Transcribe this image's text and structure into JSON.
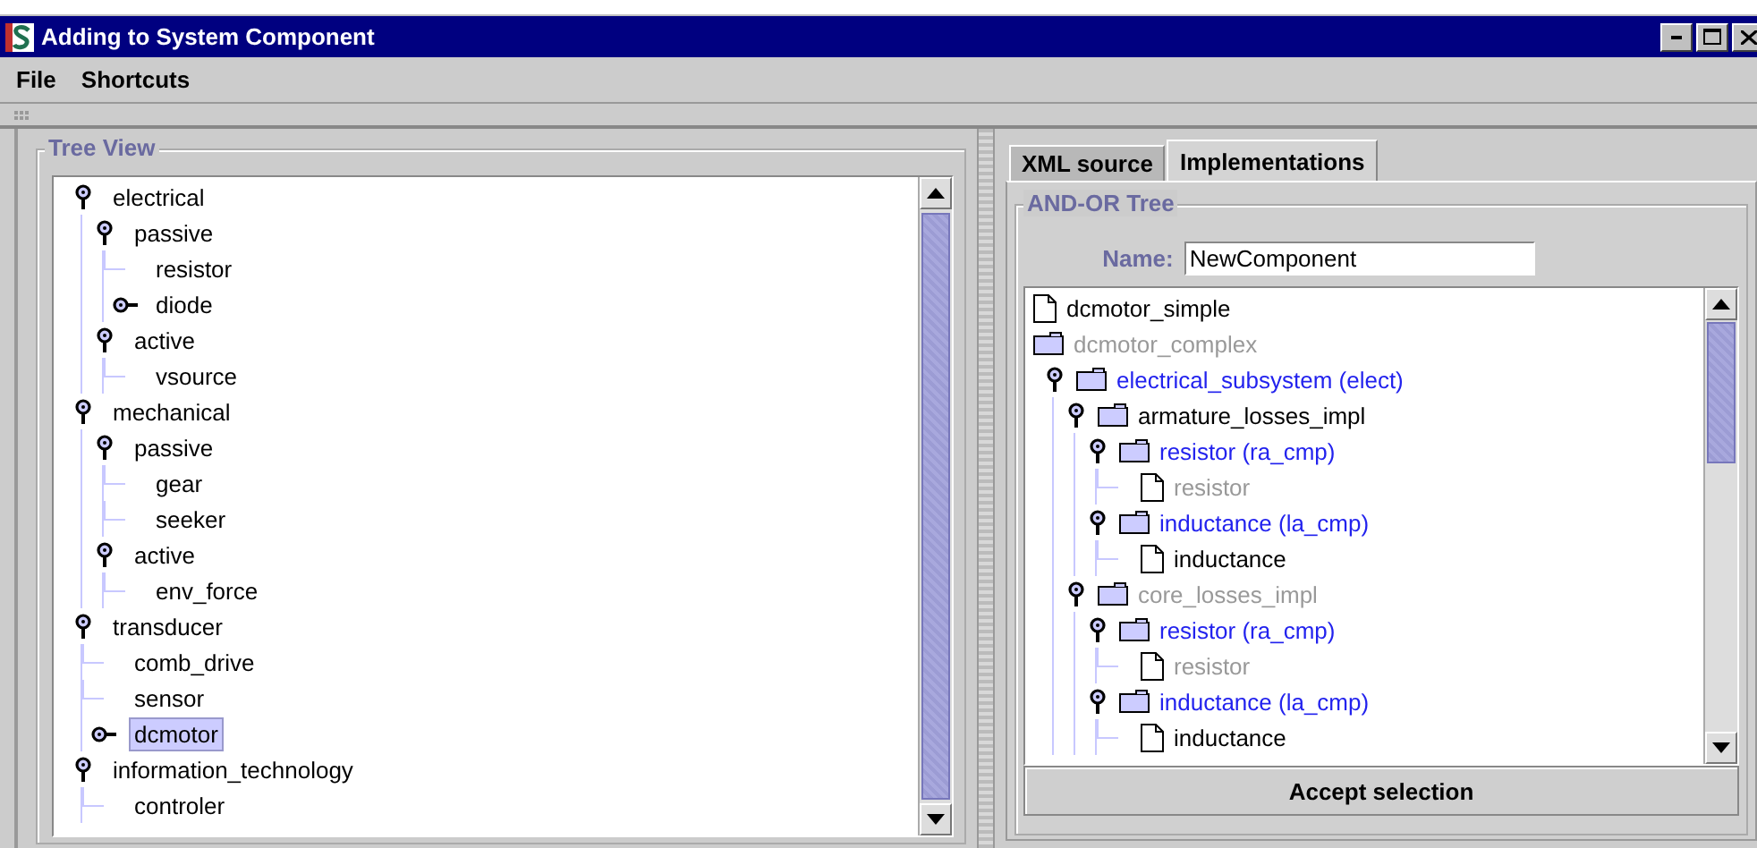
{
  "window": {
    "title": "Adding to System Component"
  },
  "menu": [
    {
      "label": "File"
    },
    {
      "label": "Shortcuts"
    }
  ],
  "tree_view": {
    "title": "Tree View",
    "items": [
      {
        "label": "electrical",
        "expanded": true,
        "selected": false,
        "children": [
          {
            "label": "passive",
            "expanded": true,
            "selected": false,
            "children": [
              {
                "label": "resistor",
                "selected": false
              },
              {
                "label": "diode",
                "expanded": false,
                "selected": false
              }
            ]
          },
          {
            "label": "active",
            "expanded": true,
            "selected": false,
            "children": [
              {
                "label": "vsource",
                "selected": false
              }
            ]
          }
        ]
      },
      {
        "label": "mechanical",
        "expanded": true,
        "selected": false,
        "children": [
          {
            "label": "passive",
            "expanded": true,
            "selected": false,
            "children": [
              {
                "label": "gear",
                "selected": false
              },
              {
                "label": "seeker",
                "selected": false
              }
            ]
          },
          {
            "label": "active",
            "expanded": true,
            "selected": false,
            "children": [
              {
                "label": "env_force",
                "selected": false
              }
            ]
          }
        ]
      },
      {
        "label": "transducer",
        "expanded": true,
        "selected": false,
        "children": [
          {
            "label": "comb_drive",
            "selected": false
          },
          {
            "label": "sensor",
            "selected": false
          },
          {
            "label": "dcmotor",
            "expanded": false,
            "selected": true
          }
        ]
      },
      {
        "label": "information_technology",
        "expanded": true,
        "selected": false,
        "children": [
          {
            "label": "controler",
            "selected": false
          }
        ]
      }
    ]
  },
  "tabs": [
    {
      "label": "XML source",
      "selected": false
    },
    {
      "label": "Implementations",
      "selected": true
    }
  ],
  "and_or_tree": {
    "title": "AND-OR Tree",
    "name_label": "Name:",
    "name_value": "NewComponent",
    "items": [
      {
        "label": "dcmotor_simple",
        "kind": "document",
        "color": "#000000"
      },
      {
        "label": "dcmotor_complex",
        "kind": "folder",
        "color": "#999999"
      },
      {
        "label": "electrical_subsystem (elect)",
        "kind": "folder",
        "color": "#2222ee",
        "expanded": true,
        "children": [
          {
            "label": "armature_losses_impl",
            "kind": "folder",
            "color": "#000000",
            "expanded": true,
            "children": [
              {
                "label": "resistor (ra_cmp)",
                "kind": "folder",
                "color": "#2222ee",
                "expanded": true,
                "children": [
                  {
                    "label": "resistor",
                    "kind": "document",
                    "color": "#999999"
                  }
                ]
              },
              {
                "label": "inductance (la_cmp)",
                "kind": "folder",
                "color": "#2222ee",
                "expanded": true,
                "children": [
                  {
                    "label": "inductance",
                    "kind": "document",
                    "color": "#000000"
                  }
                ]
              }
            ]
          },
          {
            "label": "core_losses_impl",
            "kind": "folder",
            "color": "#999999",
            "expanded": true,
            "children": [
              {
                "label": "resistor (ra_cmp)",
                "kind": "folder",
                "color": "#2222ee",
                "expanded": true,
                "children": [
                  {
                    "label": "resistor",
                    "kind": "document",
                    "color": "#999999"
                  }
                ]
              },
              {
                "label": "inductance (la_cmp)",
                "kind": "folder",
                "color": "#2222ee",
                "expanded": true,
                "children": [
                  {
                    "label": "inductance",
                    "kind": "document",
                    "color": "#000000"
                  }
                ]
              }
            ]
          }
        ]
      }
    ],
    "accept_button": "Accept selection"
  }
}
